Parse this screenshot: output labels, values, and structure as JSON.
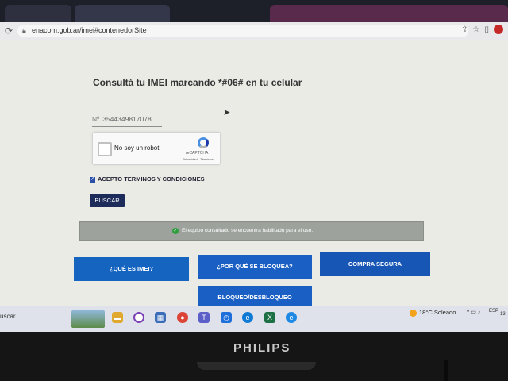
{
  "browser": {
    "url": "enacom.gob.ar/imei#contenedorSite"
  },
  "page": {
    "heading": "Consultá tu IMEI marcando *#06# en tu celular",
    "imei_prefix": "Nº",
    "imei_value": "3544349817078‹",
    "recaptcha": {
      "label": "No soy un robot",
      "brand": "reCAPTCHA",
      "links": "Privacidad - Términos"
    },
    "terms_label": "ACEPTO TERMINOS Y CONDICIONES",
    "search_button": "BUSCAR",
    "status_message": "El equipo consultado se encuentra habilitado para el uso.",
    "buttons": {
      "what_is_imei": "¿QUÉ ES IMEI?",
      "why_blocked": "¿POR QUÉ SE BLOQUEA?",
      "safe_purchase": "COMPRA SEGURA",
      "block_unblock": "BLOQUEO/DESBLOQUEO"
    }
  },
  "taskbar": {
    "search": "uscar",
    "weather": "18°C  Soleado",
    "lang": "ESP",
    "clock": "13:"
  },
  "monitor": {
    "brand": "PHILIPS"
  },
  "colors": {
    "primary_blue": "#1565c0",
    "navy": "#1c2b5a",
    "success": "#2e9e3e"
  }
}
